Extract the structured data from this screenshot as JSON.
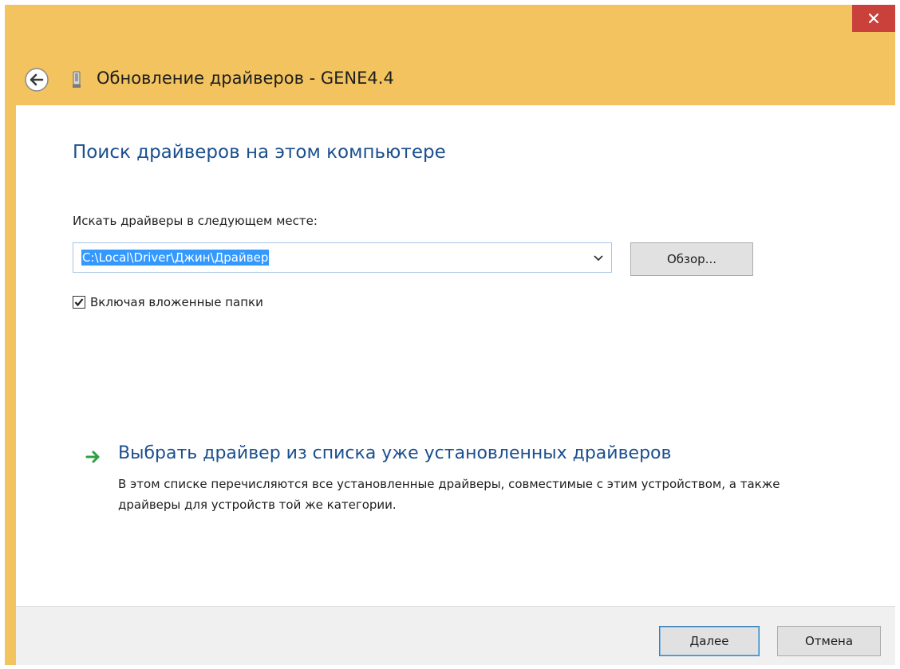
{
  "window": {
    "title": "Обновление драйверов - GENE4.4",
    "close_symbol": "✕"
  },
  "page": {
    "heading": "Поиск драйверов на этом компьютере",
    "search_label": "Искать драйверы в следующем месте:",
    "path_value": "C:\\Local\\Driver\\Джин\\Драйвер",
    "browse_label": "Обзор...",
    "include_subfolders_label": "Включая вложенные папки",
    "include_subfolders_checked": true
  },
  "pick_from_list": {
    "title": "Выбрать драйвер из списка уже установленных драйверов",
    "description": "В этом списке перечисляются все установленные драйверы, совместимые с этим устройством, а также драйверы для устройств той же категории."
  },
  "footer": {
    "next_label": "Далее",
    "cancel_label": "Отмена"
  },
  "icons": {
    "back": "back-arrow-icon",
    "device": "device-icon",
    "combo": "chevron-down-icon",
    "checkbox": "checkmark-icon",
    "link": "green-arrow-icon",
    "close": "close-icon"
  },
  "colors": {
    "title_bar": "#f2c35f",
    "close_button": "#c9413a",
    "heading_text": "#1b4f8e",
    "selection": "#3399ff",
    "link_arrow": "#2ea043"
  }
}
